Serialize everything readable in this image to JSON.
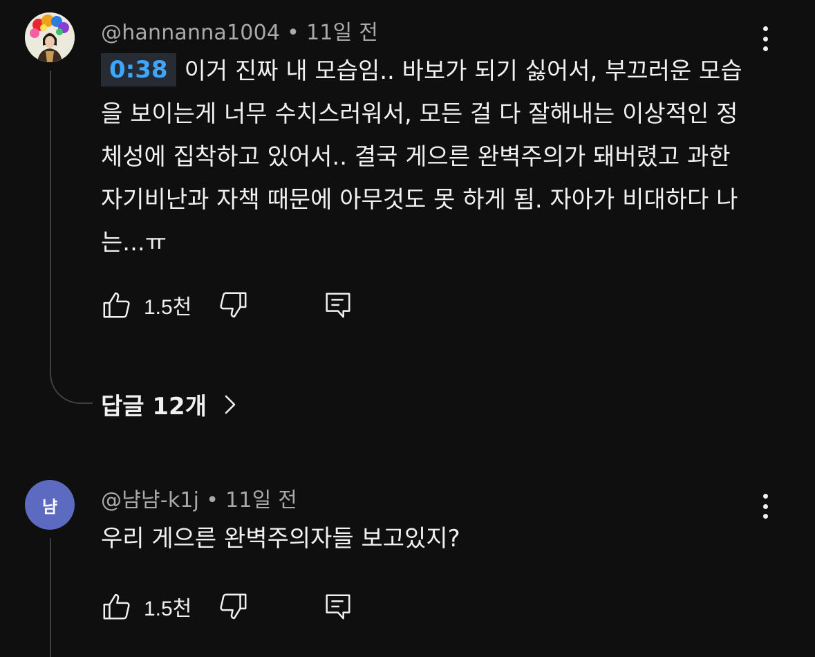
{
  "comments": [
    {
      "author": "@hannanna1004",
      "time": "11일 전",
      "timestamp_link": "0:38",
      "text": "이거 진짜 내 모습임.. 바보가 되기 싫어서, 부끄러운 모습을 보이는게 너무 수치스러워서, 모든 걸 다 잘해내는 이상적인 정체성에 집착하고 있어서.. 결국 게으른 완벽주의가 돼버렸고 과한 자기비난과 자책 때문에 아무것도 못 하게 됨. 자아가 비대하다 나는...ㅠ",
      "likes": "1.5천",
      "replies_label": "답글 12개"
    },
    {
      "author": "@냠냠-k1j",
      "time": "11일 전",
      "avatar_letter": "냠",
      "text": "우리 게으른 완벽주의자들 보고있지?",
      "likes": "1.5천"
    }
  ],
  "meta_separator": "•",
  "colors": {
    "background": "#0f0f0f",
    "text_primary": "#f1f1f1",
    "text_secondary": "#aaaaaa",
    "link_blue": "#3ea6ff",
    "avatar_purple": "#5c6bc0"
  },
  "icons": {
    "like": "thumb-up-icon",
    "dislike": "thumb-down-icon",
    "reply": "reply-icon",
    "more": "more-vert-icon",
    "chevron": "chevron-right-icon"
  }
}
